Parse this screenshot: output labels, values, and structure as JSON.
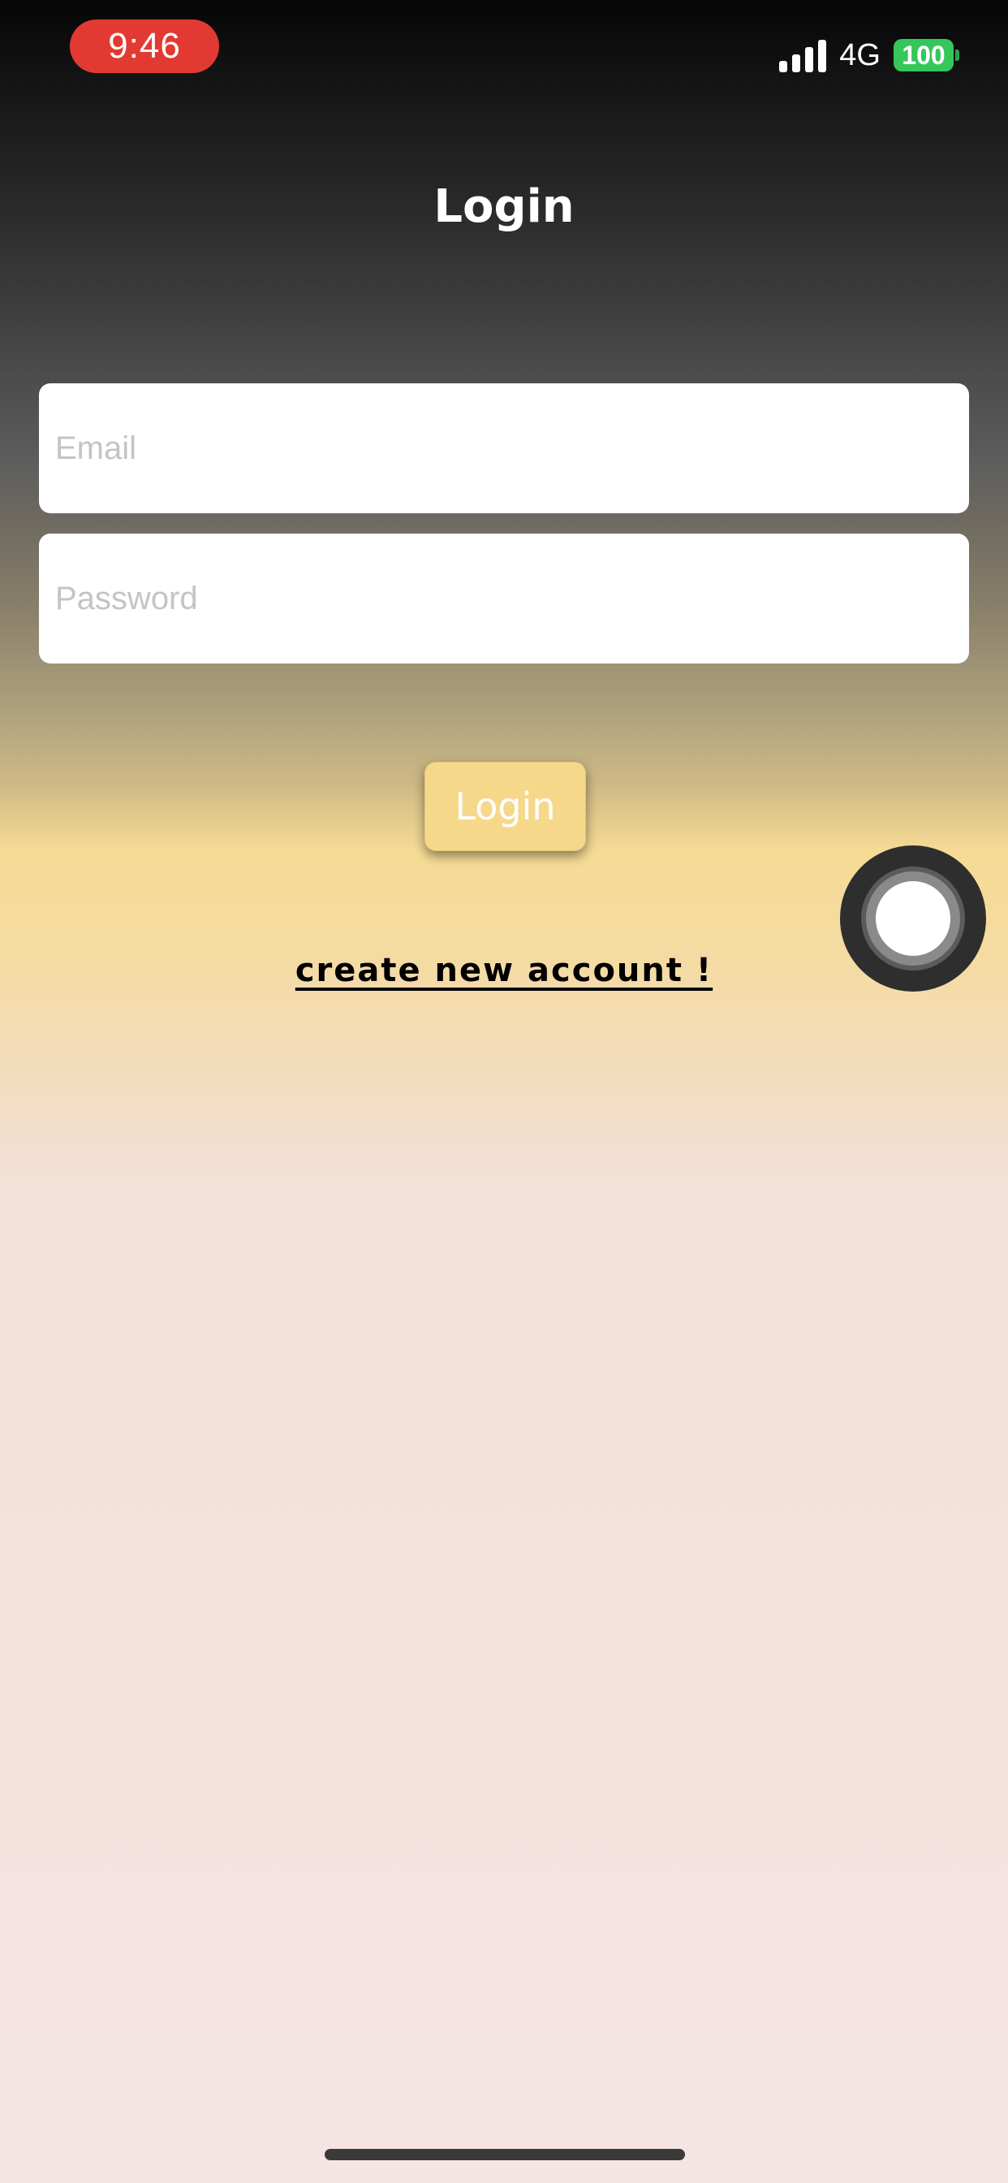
{
  "status_bar": {
    "time": "9:46",
    "network": "4G",
    "battery": "100",
    "time_pill_color": "#e23a32",
    "battery_color": "#35c759"
  },
  "header": {
    "title": "Login"
  },
  "form": {
    "email_placeholder": "Email",
    "email_value": "",
    "password_placeholder": "Password",
    "password_value": ""
  },
  "actions": {
    "login_label": "Login",
    "login_button_color": "#f6d88a",
    "create_account_label": "create new account !"
  },
  "overlay": {
    "assistive_touch_icon": "assistive-touch-icon"
  }
}
